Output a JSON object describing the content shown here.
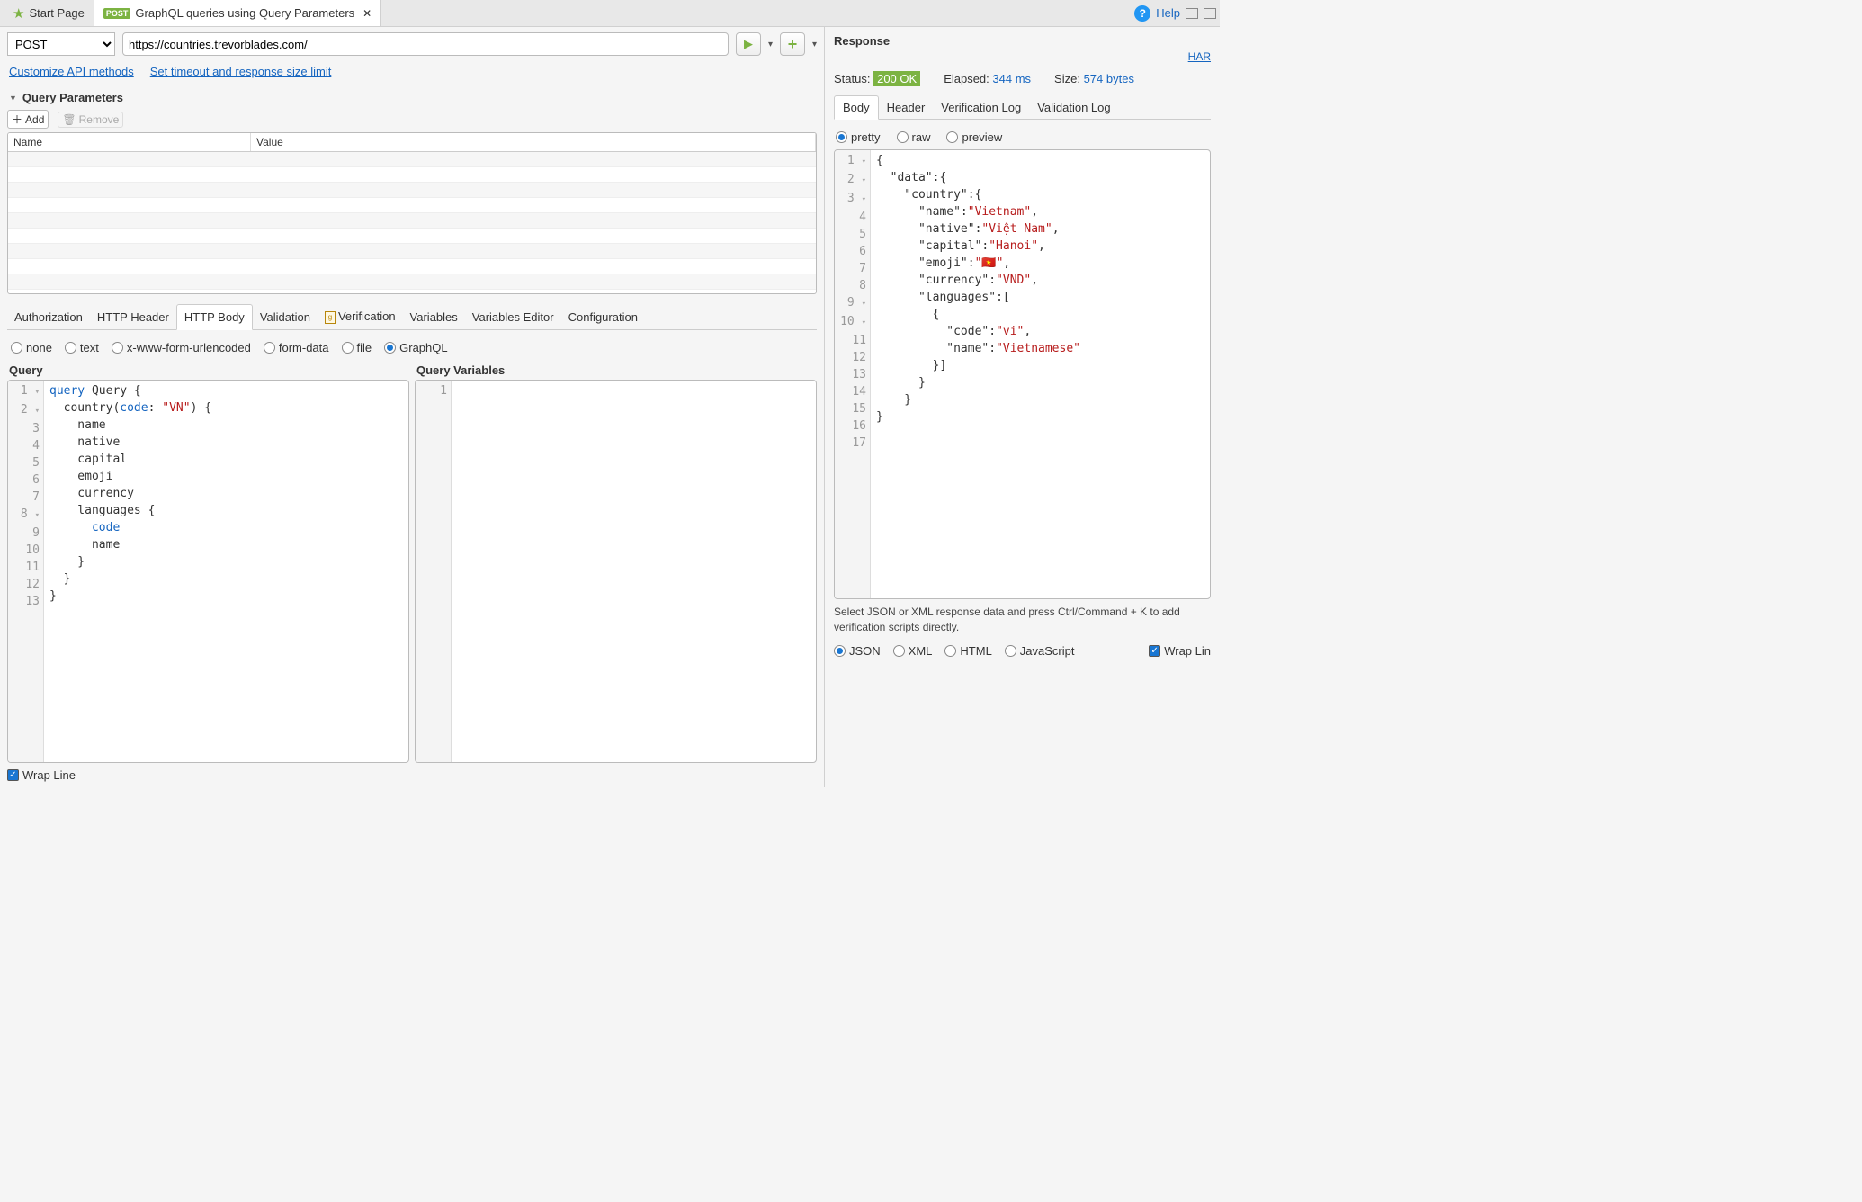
{
  "topbar": {
    "start_tab": "Start Page",
    "active_tab": "GraphQL queries using Query Parameters",
    "help": "Help"
  },
  "request": {
    "method": "POST",
    "url": "https://countries.trevorblades.com/",
    "customize_link": "Customize API methods",
    "timeout_link": "Set timeout and response size limit"
  },
  "query_params": {
    "title": "Query Parameters",
    "add": "Add",
    "remove": "Remove",
    "col_name": "Name",
    "col_value": "Value"
  },
  "req_tabs": {
    "authorization": "Authorization",
    "http_header": "HTTP Header",
    "http_body": "HTTP Body",
    "validation": "Validation",
    "verification": "Verification",
    "variables": "Variables",
    "variables_editor": "Variables Editor",
    "configuration": "Configuration"
  },
  "body_types": {
    "none": "none",
    "text": "text",
    "xwww": "x-www-form-urlencoded",
    "formdata": "form-data",
    "file": "file",
    "graphql": "GraphQL"
  },
  "editor": {
    "query_label": "Query",
    "vars_label": "Query Variables",
    "wrap_line": "Wrap Line",
    "query_lines": [
      "1",
      "2",
      "3",
      "4",
      "5",
      "6",
      "7",
      "8",
      "9",
      "10",
      "11",
      "12",
      "13"
    ]
  },
  "graphql_query": {
    "line1_a": "query",
    "line1_b": " Query {",
    "line2_a": "  country(",
    "line2_b": "code",
    "line2_c": ": ",
    "line2_d": "\"VN\"",
    "line2_e": ") {",
    "line3": "    name",
    "line4": "    native",
    "line5": "    capital",
    "line6": "    emoji",
    "line7": "    currency",
    "line8": "    languages {",
    "line9_a": "      ",
    "line9_b": "code",
    "line10": "      name",
    "line11": "    }",
    "line12": "  }",
    "line13": "}"
  },
  "response": {
    "title": "Response",
    "har": "HAR",
    "status_label": "Status:",
    "status_value": "200 OK",
    "elapsed_label": "Elapsed:",
    "elapsed_value": "344 ms",
    "size_label": "Size:",
    "size_value": "574 bytes",
    "tabs": {
      "body": "Body",
      "header": "Header",
      "verif": "Verification Log",
      "valid": "Validation Log"
    },
    "views": {
      "pretty": "pretty",
      "raw": "raw",
      "preview": "preview"
    },
    "hint": "Select JSON or XML response data and press Ctrl/Command + K to add verification scripts directly.",
    "formats": {
      "json": "JSON",
      "xml": "XML",
      "html": "HTML",
      "js": "JavaScript",
      "wrap": "Wrap Lin"
    },
    "lines": [
      "1",
      "2",
      "3",
      "4",
      "5",
      "6",
      "7",
      "8",
      "9",
      "10",
      "11",
      "12",
      "13",
      "14",
      "15",
      "16",
      "17"
    ]
  },
  "resp_json": {
    "l1": "{",
    "l2a": "  \"data\"",
    "l2b": ":{",
    "l3a": "    \"country\"",
    "l3b": ":{",
    "l4a": "      \"name\"",
    "l4b": ":",
    "l4c": "\"Vietnam\"",
    "l4d": ",",
    "l5a": "      \"native\"",
    "l5b": ":",
    "l5c": "\"Việt Nam\"",
    "l5d": ",",
    "l6a": "      \"capital\"",
    "l6b": ":",
    "l6c": "\"Hanoi\"",
    "l6d": ",",
    "l7a": "      \"emoji\"",
    "l7b": ":",
    "l7c": "\"🇻🇳\"",
    "l7d": ",",
    "l8a": "      \"currency\"",
    "l8b": ":",
    "l8c": "\"VND\"",
    "l8d": ",",
    "l9a": "      \"languages\"",
    "l9b": ":[",
    "l10": "        {",
    "l11a": "          \"code\"",
    "l11b": ":",
    "l11c": "\"vi\"",
    "l11d": ",",
    "l12a": "          \"name\"",
    "l12b": ":",
    "l12c": "\"Vietnamese\"",
    "l13": "        }]",
    "l14": "      }",
    "l15": "    }",
    "l16": "}",
    "l17": ""
  }
}
